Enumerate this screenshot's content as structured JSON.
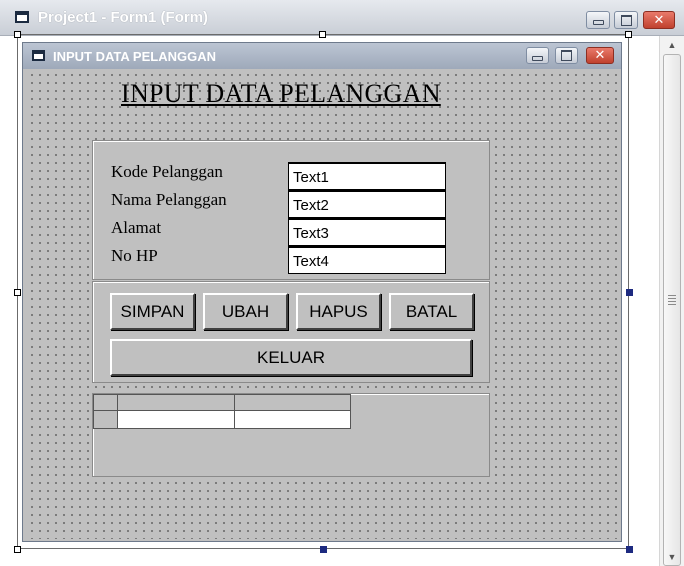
{
  "window": {
    "title": "Project1 - Form1 (Form)"
  },
  "form": {
    "title": "INPUT DATA PELANGGAN",
    "caption": "INPUT DATA PELANGGAN",
    "fields": [
      {
        "label": "Kode Pelanggan",
        "value": "Text1"
      },
      {
        "label": "Nama Pelanggan",
        "value": "Text2"
      },
      {
        "label": "Alamat",
        "value": "Text3"
      },
      {
        "label": "No HP",
        "value": "Text4"
      }
    ],
    "buttons": {
      "simpan": "SIMPAN",
      "ubah": "UBAH",
      "hapus": "HAPUS",
      "batal": "BATAL",
      "keluar": "KELUAR"
    }
  },
  "icons": {
    "app": "form-icon",
    "minimize": "minimize-icon",
    "maximize": "maximize-icon",
    "close": "close-icon",
    "scroll_up": "arrow-up-icon",
    "scroll_down": "arrow-down-icon"
  },
  "colors": {
    "form_background": "#c0c0c0",
    "close_button": "#c0412e",
    "inactive_titlebar": "#9ea9ba"
  }
}
